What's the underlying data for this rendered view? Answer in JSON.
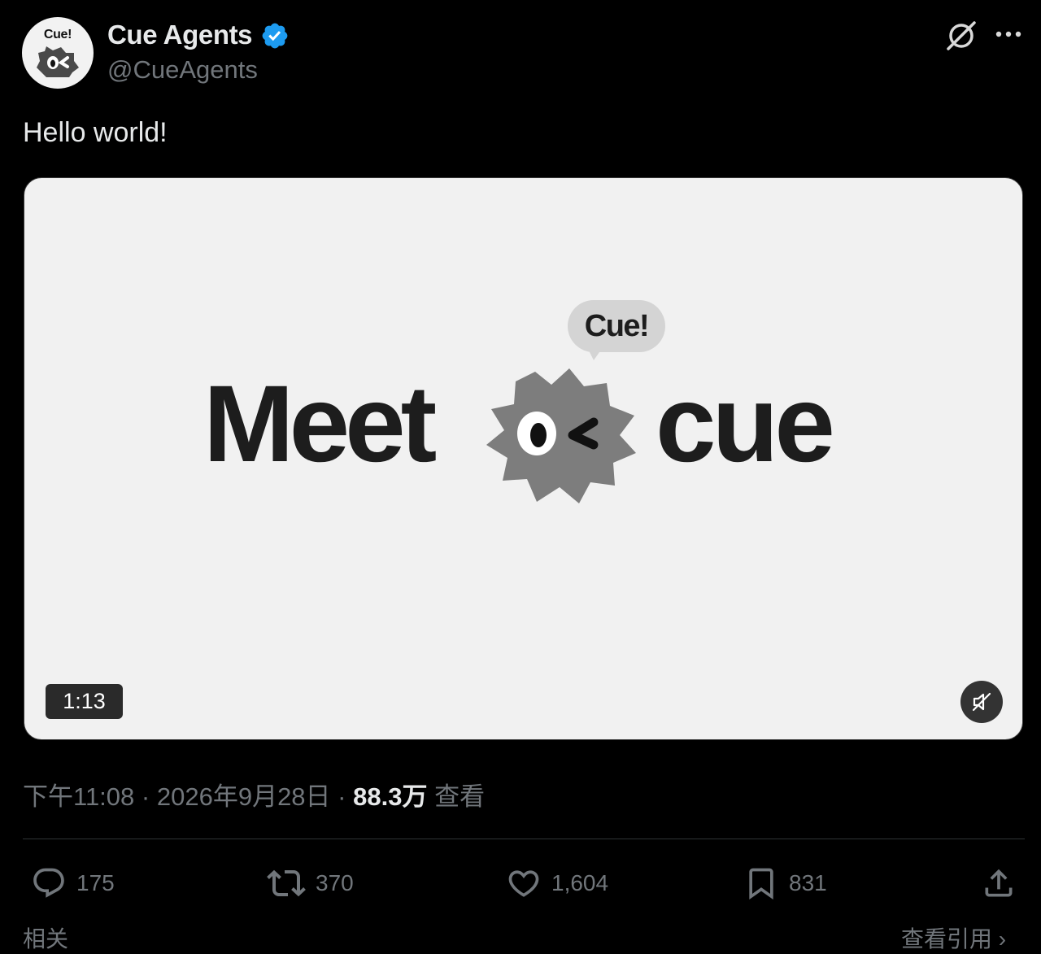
{
  "author": {
    "avatar_text": "Cue!",
    "name": "Cue Agents",
    "handle": "@CueAgents"
  },
  "header_icons": [
    "grok-icon",
    "more-icon"
  ],
  "tweet": {
    "text": "Hello world!"
  },
  "media": {
    "headline_left": "Meet",
    "headline_right": "cue",
    "bubble_text": "Cue!",
    "duration": "1:13",
    "muted": true
  },
  "meta": {
    "time": "下午11:08",
    "separator": "·",
    "date": "2026年9月28日",
    "views_count": "88.3万",
    "views_label": "查看"
  },
  "actions": {
    "replies": "175",
    "reposts": "370",
    "likes": "1,604",
    "bookmarks": "831"
  },
  "bottom": {
    "left_text": "相关",
    "right_text": "查看引用 ›"
  },
  "colors": {
    "background": "#000000",
    "text_primary": "#e7e9ea",
    "text_secondary": "#71767b",
    "verified": "#1d9bf0",
    "media_bg": "#f1f1f1"
  }
}
